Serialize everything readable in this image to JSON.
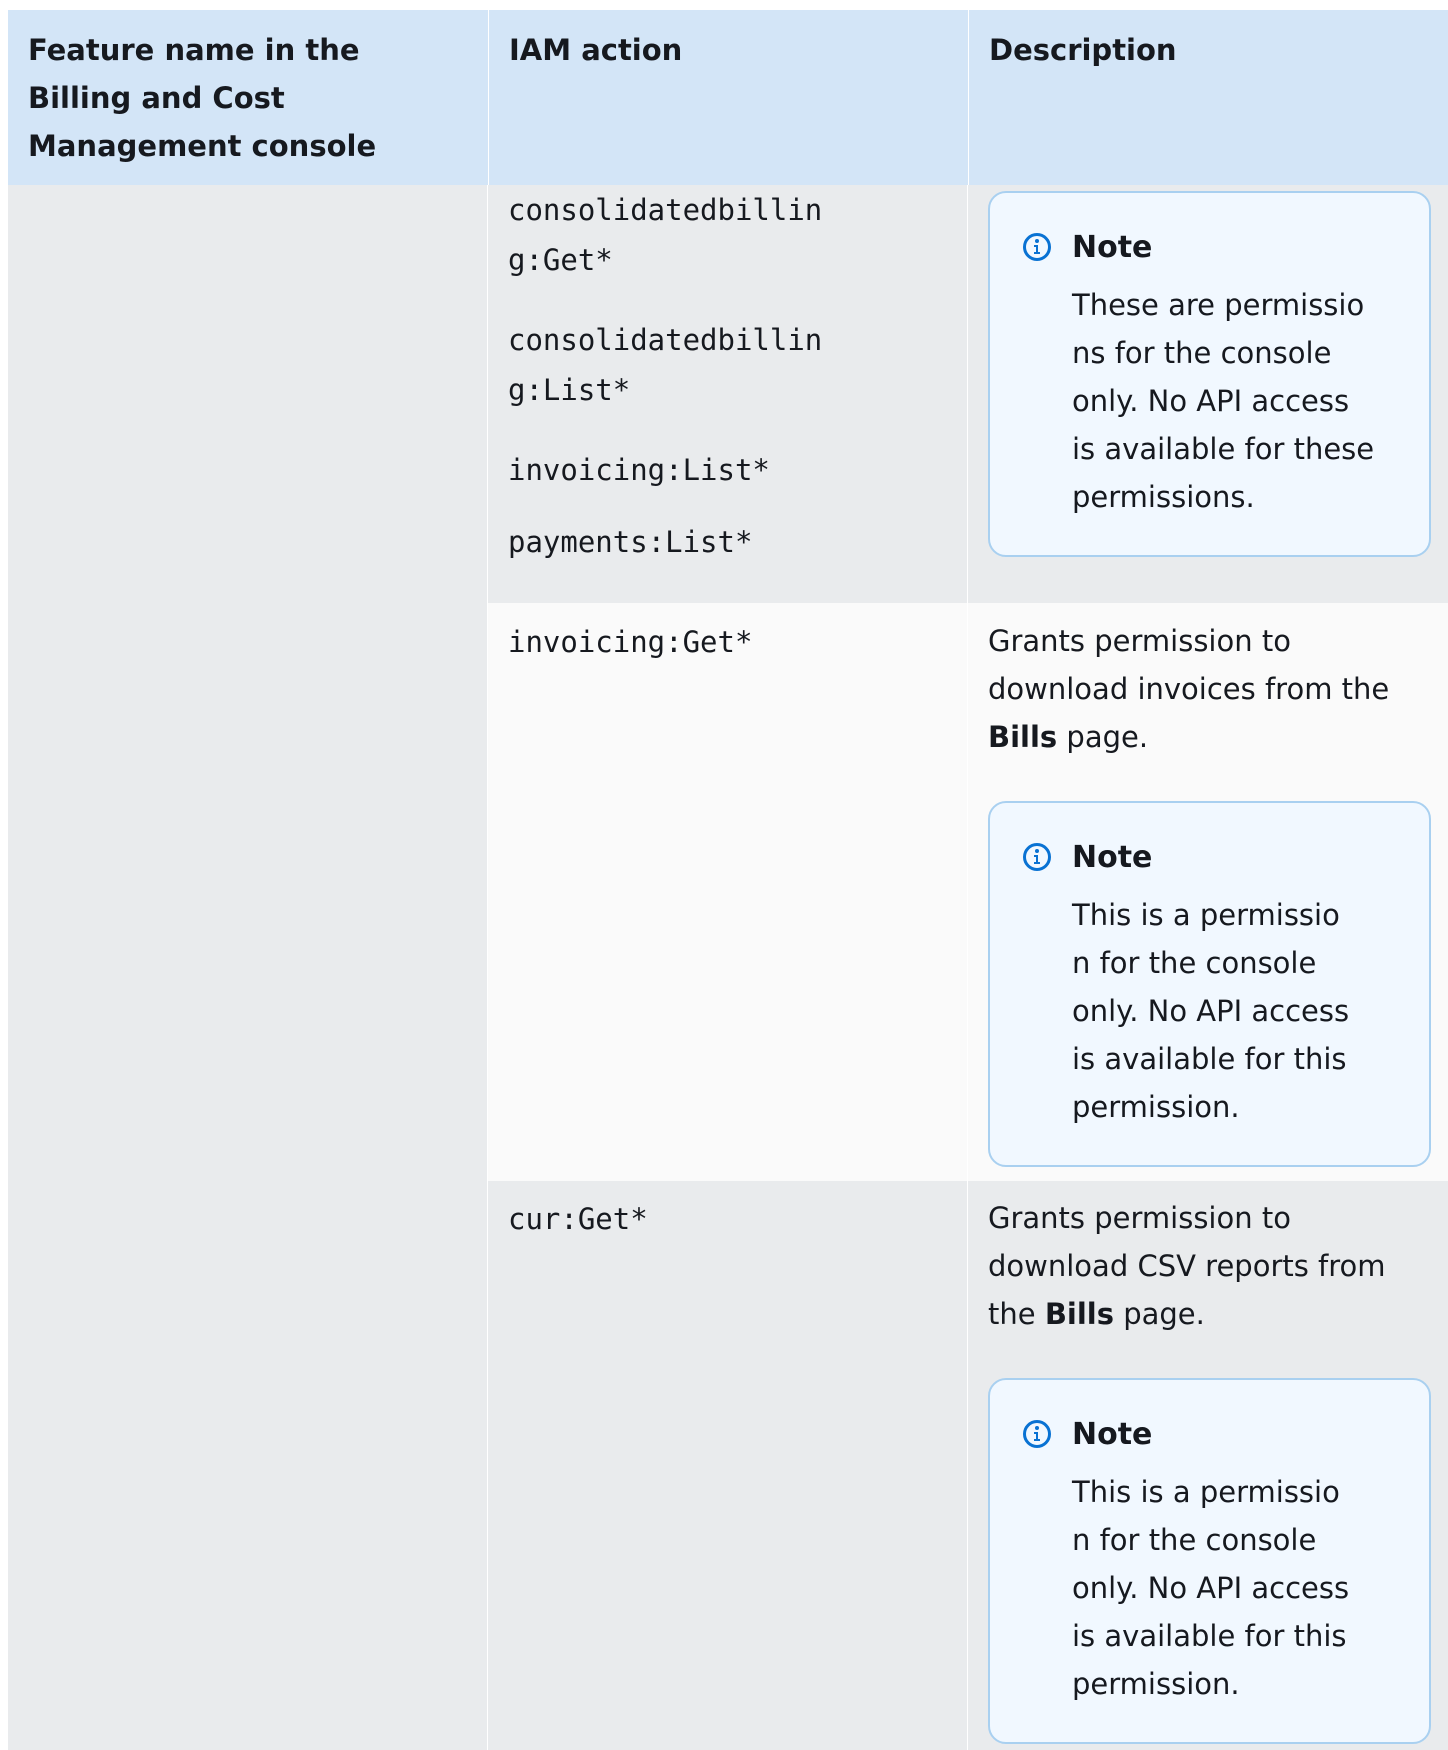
{
  "table": {
    "headers": {
      "feature": "Feature name in the Billing and Cost Management console",
      "iam": "IAM action",
      "description": "Description"
    },
    "rows": [
      {
        "actions": [
          "consolidatedbillin\ng:Get*",
          "consolidatedbillin\ng:List*",
          "invoicing:List*",
          "payments:List*"
        ],
        "note": {
          "title": "Note",
          "body": "These are permissio\nns for the console\nonly. No API access\nis available for these\npermissions."
        }
      },
      {
        "actions": [
          "invoicing:Get*"
        ],
        "description": {
          "before": "Grants permission to download invoices from the ",
          "bold": "Bills",
          "after": " page."
        },
        "note": {
          "title": "Note",
          "body": "This is a permissio\nn for the console\nonly. No API access\nis available for this\npermission."
        }
      },
      {
        "actions": [
          "cur:Get*"
        ],
        "description": {
          "before": "Grants permission to download CSV reports from the ",
          "bold": "Bills",
          "after": " page."
        },
        "note": {
          "title": "Note",
          "body": "This is a permissio\nn for the console\nonly. No API access\nis available for this\npermission."
        }
      }
    ]
  },
  "colors": {
    "header_bg": "#d3e5f7",
    "row_shade": "#e9ebed",
    "row_light": "#fafafa",
    "note_bg": "#f1f8ff",
    "note_border": "#a9d0f0",
    "info_icon": "#0972d3"
  },
  "icons": {
    "note": "info-circle-icon"
  }
}
